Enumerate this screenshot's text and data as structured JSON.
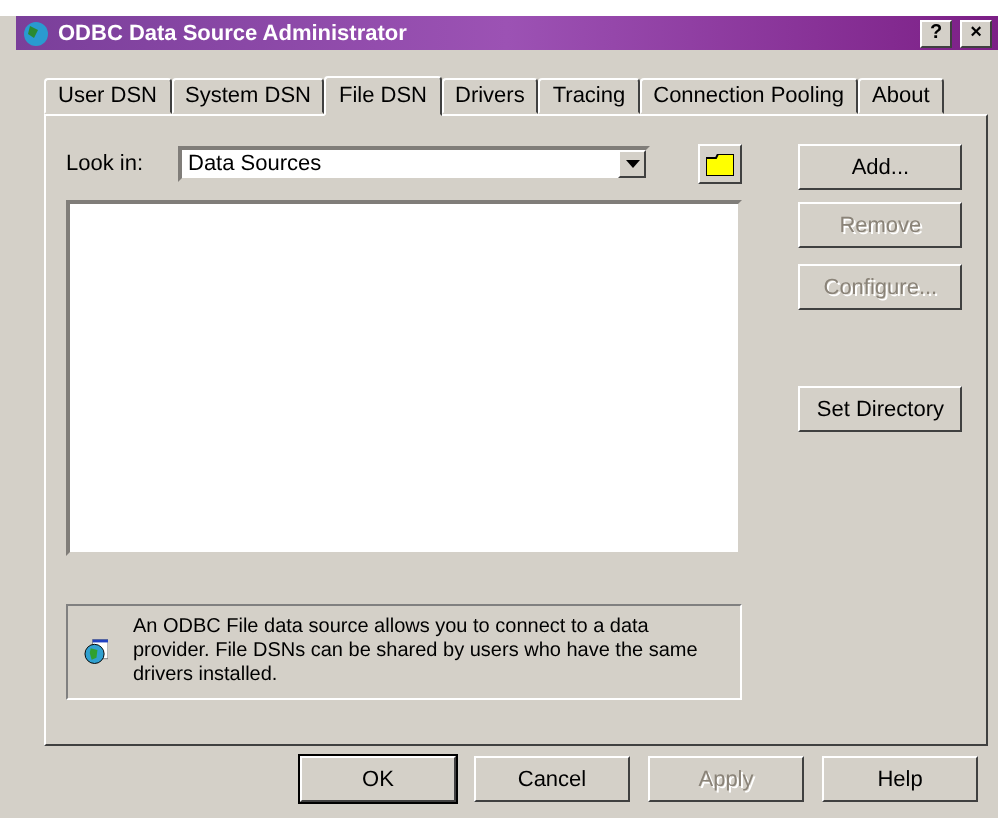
{
  "window": {
    "title": "ODBC Data Source Administrator",
    "help_button": "?",
    "close_button": "×"
  },
  "tabs": [
    {
      "label": "User DSN",
      "selected": false
    },
    {
      "label": "System DSN",
      "selected": false
    },
    {
      "label": "File DSN",
      "selected": true
    },
    {
      "label": "Drivers",
      "selected": false
    },
    {
      "label": "Tracing",
      "selected": false
    },
    {
      "label": "Connection Pooling",
      "selected": false
    },
    {
      "label": "About",
      "selected": false
    }
  ],
  "look_in": {
    "label": "Look in:",
    "value": "Data Sources"
  },
  "side_buttons": [
    {
      "label": "Add...",
      "disabled": false
    },
    {
      "label": "Remove",
      "disabled": true
    },
    {
      "label": "Configure...",
      "disabled": true
    },
    {
      "label": "Set Directory",
      "disabled": false
    }
  ],
  "info": "An ODBC File data source allows you to connect to a data provider.  File DSNs can be shared by users who have the same drivers installed.",
  "buttons": [
    {
      "label": "OK",
      "disabled": false,
      "default": true
    },
    {
      "label": "Cancel",
      "disabled": false,
      "default": false
    },
    {
      "label": "Apply",
      "disabled": true,
      "default": false
    },
    {
      "label": "Help",
      "disabled": false,
      "default": false
    }
  ]
}
